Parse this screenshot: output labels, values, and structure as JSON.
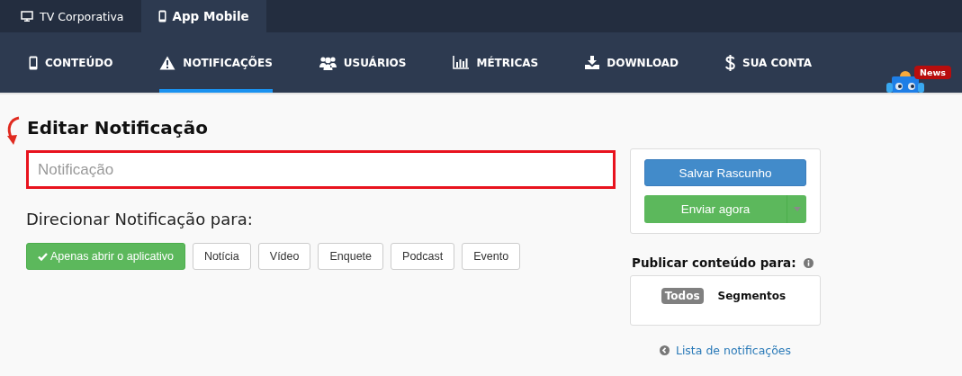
{
  "top_tabs": [
    {
      "label": "TV Corporativa",
      "selected": false
    },
    {
      "label": "App Mobile",
      "selected": true
    }
  ],
  "nav": [
    {
      "label": "CONTEÚDO",
      "selected": false
    },
    {
      "label": "NOTIFICAÇÕES",
      "selected": true
    },
    {
      "label": "USUÁRIOS",
      "selected": false
    },
    {
      "label": "MÉTRICAS",
      "selected": false
    },
    {
      "label": "DOWNLOAD",
      "selected": false
    },
    {
      "label": "SUA CONTA",
      "selected": false
    }
  ],
  "news_badge": "News",
  "page_title": "Editar Notificação",
  "notification_field": {
    "placeholder": "Notificação"
  },
  "target_label": "Direcionar Notificação para:",
  "targets": [
    {
      "label": "Apenas abrir o aplicativo",
      "selected": true
    },
    {
      "label": "Notícia",
      "selected": false
    },
    {
      "label": "Vídeo",
      "selected": false
    },
    {
      "label": "Enquete",
      "selected": false
    },
    {
      "label": "Podcast",
      "selected": false
    },
    {
      "label": "Evento",
      "selected": false
    }
  ],
  "save_button": "Salvar Rascunho",
  "send_button": "Enviar agora",
  "publish_label": "Publicar conteúdo para:",
  "audience": [
    {
      "label": "Todos",
      "selected": true
    },
    {
      "label": "Segmentos",
      "selected": false
    }
  ],
  "back_link": "Lista de notificações"
}
